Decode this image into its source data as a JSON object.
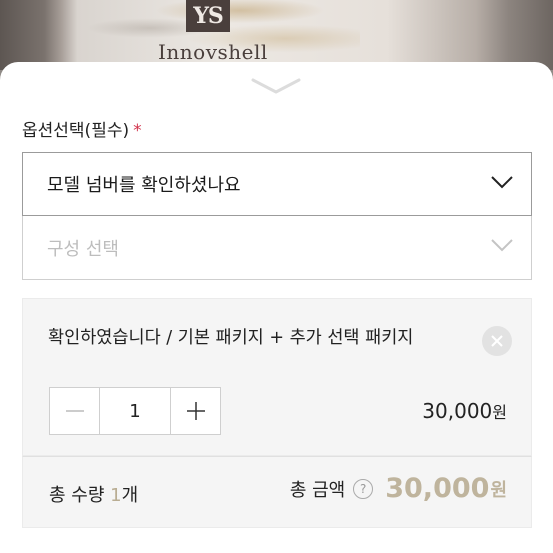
{
  "product_image": {
    "logo_mark": "YS",
    "brand_text": "Innovshell"
  },
  "options": {
    "section_label": "옵션선택(필수)",
    "required_mark": "*",
    "model_select_value": "모델 넘버를 확인하셨나요",
    "composition_select_placeholder": "구성 선택"
  },
  "selected_item": {
    "title": "확인하였습니다 / 기본 패키지 + 추가 선택 패키지",
    "quantity": "1",
    "price": "30,000",
    "price_unit": "원"
  },
  "summary": {
    "quantity_label": "총 수량",
    "quantity_value": "1",
    "quantity_unit": "개",
    "amount_label": "총 금액",
    "help_symbol": "?",
    "amount_value": "30,000",
    "amount_unit": "원"
  },
  "colors": {
    "accent_gold": "#bfb49d",
    "required_red": "#d2334c"
  }
}
